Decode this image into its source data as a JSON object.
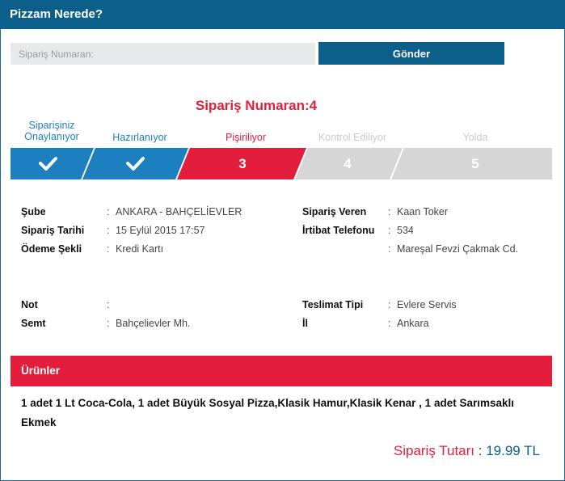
{
  "header": {
    "title": "Pizzam Nerede?"
  },
  "search": {
    "placeholder": "Sipariş Numaran:",
    "button_label": "Gönder"
  },
  "order": {
    "title": "Sipariş Numaran:4"
  },
  "steps": [
    {
      "label_line1": "Siparişiniz",
      "label_line2": "Onaylanıyor",
      "status": "done",
      "number": "",
      "icon": "check-icon"
    },
    {
      "label_line1": "Hazırlanıyor",
      "label_line2": "",
      "status": "done",
      "number": "",
      "icon": "check-icon"
    },
    {
      "label_line1": "Pişiriliyor",
      "label_line2": "",
      "status": "active",
      "number": "3",
      "icon": ""
    },
    {
      "label_line1": "Kontrol Ediliyor",
      "label_line2": "",
      "status": "pending",
      "number": "4",
      "icon": ""
    },
    {
      "label_line1": "Yolda",
      "label_line2": "",
      "status": "pending",
      "number": "5",
      "icon": ""
    }
  ],
  "colors": {
    "done": "#1b7fc0",
    "active": "#e21e3c",
    "pending": "#d6d6d6",
    "brand": "#0b5f8a"
  },
  "details_left": [
    {
      "label": "Şube",
      "sep": ":",
      "value": "ANKARA - BAHÇELİEVLER"
    },
    {
      "label": "Sipariş Tarihi",
      "sep": ":",
      "value": "15 Eylül 2015 17:57"
    },
    {
      "label": "Ödeme Şekli",
      "sep": ":",
      "value": "Kredi Kartı"
    },
    {
      "label": "Not",
      "sep": ":",
      "value": ""
    },
    {
      "label": "Semt",
      "sep": ":",
      "value": "Bahçelievler Mh."
    }
  ],
  "details_right": [
    {
      "label": "Sipariş Veren",
      "sep": ":",
      "value": "Kaan Toker"
    },
    {
      "label": "İrtibat Telefonu",
      "sep": ":",
      "value": "534"
    },
    {
      "label": "",
      "sep": ":",
      "value": "Mareşal Fevzi Çakmak Cd."
    },
    {
      "label": "Teslimat Tipi",
      "sep": ":",
      "value": "Evlere Servis"
    },
    {
      "label": "İl",
      "sep": ":",
      "value": "Ankara"
    }
  ],
  "products": {
    "title": "Ürünler",
    "text": "1 adet 1 Lt Coca-Cola, 1 adet Büyük Sosyal Pizza,Klasik Hamur,Klasik Kenar , 1 adet Sarımsaklı Ekmek"
  },
  "total": {
    "label": "Sipariş Tutarı",
    "sep": " : ",
    "value": "19.99 TL"
  }
}
